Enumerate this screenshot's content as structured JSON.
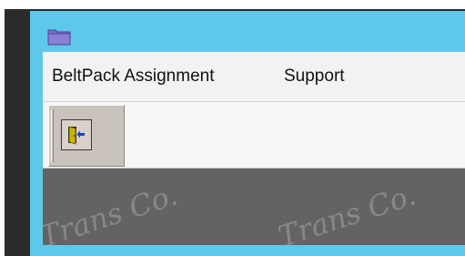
{
  "window": {
    "title_icon": "folder-icon"
  },
  "menu": {
    "items": [
      {
        "label": "BeltPack Assignment"
      },
      {
        "label": "Support"
      }
    ]
  },
  "toolbar": {
    "buttons": [
      {
        "icon": "exit-door-icon"
      }
    ]
  },
  "workspace": {
    "watermark_text": "Trans Co.",
    "watermark_text_2": "Trans Co."
  },
  "colors": {
    "titlebar": "#5ec8ea",
    "workspace": "#636363",
    "menubar": "#f2f2f2",
    "folder": "#7a6fc9"
  }
}
